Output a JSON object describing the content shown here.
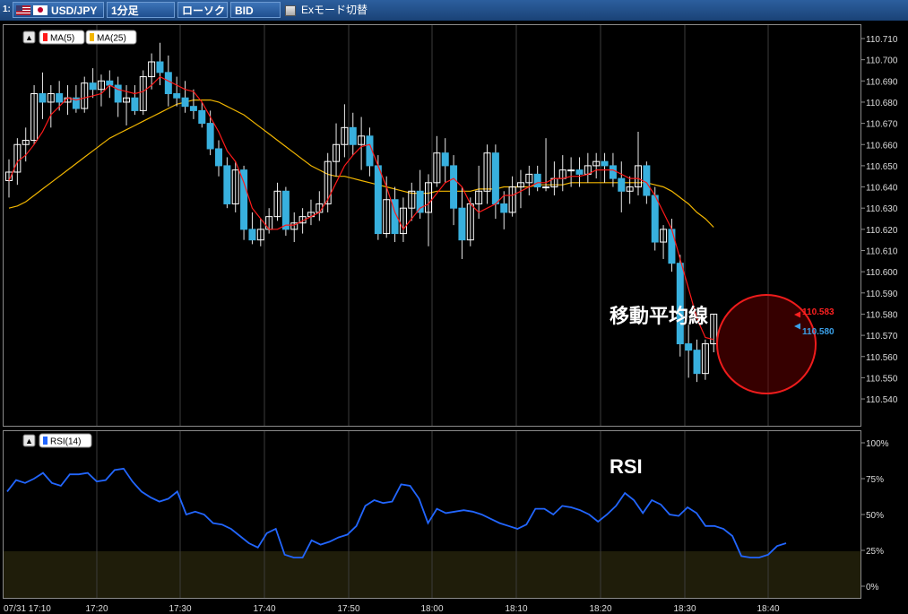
{
  "toolbar": {
    "index": "1:",
    "pair": "USD/JPY",
    "timeframe": "1分足",
    "chart_type": "ローソク",
    "price_type": "BID",
    "ex_mode": "Exモード切替"
  },
  "colors": {
    "bull": "#ffffff",
    "bear": "#38b0de",
    "wick": "#e8e8e8",
    "ma5": "#ff1a1a",
    "ma25": "#f2b600",
    "rsi": "#2266ff",
    "grid": "#3b3b3b",
    "oversold_zone": "#1f1d0a"
  },
  "chart_data": [
    {
      "type": "candlestick",
      "legend": [
        "MA(5)",
        "MA(25)"
      ],
      "annotation": "移動平均線",
      "price_labels": {
        "ma": "110.583",
        "bid": "110.580"
      },
      "ylim": [
        110.535,
        110.715
      ],
      "y_ticks": [
        "110.710",
        "110.700",
        "110.690",
        "110.680",
        "110.670",
        "110.660",
        "110.650",
        "110.640",
        "110.630",
        "110.620",
        "110.610",
        "110.600",
        "110.590",
        "110.580",
        "110.570",
        "110.560",
        "110.550",
        "110.540"
      ],
      "x_ticks": [
        "07/31 17:10",
        "17:20",
        "17:30",
        "17:40",
        "17:50",
        "18:00",
        "18:10",
        "18:20",
        "18:30",
        "18:40"
      ],
      "ohlc": [
        [
          110.643,
          110.653,
          110.635,
          110.647
        ],
        [
          110.647,
          110.663,
          110.641,
          110.66
        ],
        [
          110.66,
          110.668,
          110.652,
          110.662
        ],
        [
          110.662,
          110.688,
          110.66,
          110.684
        ],
        [
          110.684,
          110.694,
          110.672,
          110.68
        ],
        [
          110.68,
          110.688,
          110.668,
          110.684
        ],
        [
          110.684,
          110.69,
          110.676,
          110.68
        ],
        [
          110.68,
          110.688,
          110.674,
          110.682
        ],
        [
          110.682,
          110.688,
          110.675,
          110.677
        ],
        [
          110.677,
          110.692,
          110.675,
          110.689
        ],
        [
          110.689,
          110.696,
          110.682,
          110.686
        ],
        [
          110.686,
          110.693,
          110.678,
          110.69
        ],
        [
          110.69,
          110.695,
          110.682,
          110.688
        ],
        [
          110.688,
          110.692,
          110.673,
          110.68
        ],
        [
          110.68,
          110.688,
          110.669,
          110.682
        ],
        [
          110.682,
          110.688,
          110.674,
          110.676
        ],
        [
          110.676,
          110.695,
          110.674,
          110.692
        ],
        [
          110.692,
          110.703,
          110.686,
          110.699
        ],
        [
          110.699,
          110.708,
          110.688,
          110.694
        ],
        [
          110.694,
          110.702,
          110.678,
          110.684
        ],
        [
          110.684,
          110.692,
          110.678,
          110.682
        ],
        [
          110.682,
          110.69,
          110.675,
          110.678
        ],
        [
          110.678,
          110.686,
          110.672,
          110.676
        ],
        [
          110.676,
          110.68,
          110.668,
          110.67
        ],
        [
          110.67,
          110.676,
          110.655,
          110.658
        ],
        [
          110.658,
          110.662,
          110.645,
          110.65
        ],
        [
          110.65,
          110.654,
          110.63,
          110.632
        ],
        [
          110.632,
          110.652,
          110.628,
          110.648
        ],
        [
          110.648,
          110.65,
          110.615,
          110.62
        ],
        [
          110.62,
          110.628,
          110.613,
          110.615
        ],
        [
          110.615,
          110.625,
          110.612,
          110.62
        ],
        [
          110.62,
          110.63,
          110.618,
          110.626
        ],
        [
          110.626,
          110.642,
          110.624,
          110.638
        ],
        [
          110.638,
          110.64,
          110.617,
          110.62
        ],
        [
          110.62,
          110.628,
          110.614,
          110.623
        ],
        [
          110.623,
          110.63,
          110.618,
          110.626
        ],
        [
          110.626,
          110.634,
          110.622,
          110.628
        ],
        [
          110.628,
          110.638,
          110.624,
          110.632
        ],
        [
          110.632,
          110.656,
          110.628,
          110.652
        ],
        [
          110.652,
          110.67,
          110.645,
          110.66
        ],
        [
          110.66,
          110.679,
          110.654,
          110.668
        ],
        [
          110.668,
          110.675,
          110.655,
          110.66
        ],
        [
          110.66,
          110.673,
          110.648,
          110.664
        ],
        [
          110.664,
          110.668,
          110.645,
          110.65
        ],
        [
          110.65,
          110.655,
          110.615,
          110.618
        ],
        [
          110.618,
          110.645,
          110.616,
          110.634
        ],
        [
          110.634,
          110.64,
          110.614,
          110.618
        ],
        [
          110.618,
          110.635,
          110.614,
          110.63
        ],
        [
          110.63,
          110.642,
          110.624,
          110.638
        ],
        [
          110.638,
          110.648,
          110.625,
          110.628
        ],
        [
          110.628,
          110.646,
          110.612,
          110.642
        ],
        [
          110.642,
          110.664,
          110.64,
          110.656
        ],
        [
          110.656,
          110.663,
          110.642,
          110.65
        ],
        [
          110.65,
          110.655,
          110.622,
          110.63
        ],
        [
          110.63,
          110.64,
          110.606,
          110.615
        ],
        [
          110.615,
          110.635,
          110.612,
          110.632
        ],
        [
          110.632,
          110.65,
          110.625,
          110.638
        ],
        [
          110.638,
          110.66,
          110.632,
          110.656
        ],
        [
          110.656,
          110.66,
          110.625,
          110.632
        ],
        [
          110.632,
          110.638,
          110.62,
          110.628
        ],
        [
          110.628,
          110.645,
          110.626,
          110.64
        ],
        [
          110.64,
          110.648,
          110.63,
          110.642
        ],
        [
          110.642,
          110.65,
          110.636,
          110.646
        ],
        [
          110.646,
          110.65,
          110.638,
          110.64
        ],
        [
          110.64,
          110.663,
          110.638,
          110.64
        ],
        [
          110.64,
          110.652,
          110.636,
          110.644
        ],
        [
          110.644,
          110.655,
          110.638,
          110.648
        ],
        [
          110.648,
          110.654,
          110.64,
          110.648
        ],
        [
          110.648,
          110.654,
          110.64,
          110.646
        ],
        [
          110.646,
          110.656,
          110.642,
          110.65
        ],
        [
          110.65,
          110.656,
          110.644,
          110.652
        ],
        [
          110.652,
          110.656,
          110.642,
          110.65
        ],
        [
          110.65,
          110.656,
          110.64,
          110.644
        ],
        [
          110.644,
          110.652,
          110.628,
          110.638
        ],
        [
          110.638,
          110.645,
          110.632,
          110.64
        ],
        [
          110.64,
          110.666,
          110.636,
          110.65
        ],
        [
          110.65,
          110.652,
          110.632,
          110.636
        ],
        [
          110.636,
          110.64,
          110.61,
          110.614
        ],
        [
          110.614,
          110.622,
          110.606,
          110.62
        ],
        [
          110.62,
          110.625,
          110.6,
          110.604
        ],
        [
          110.604,
          110.608,
          110.56,
          110.566
        ],
        [
          110.566,
          110.575,
          110.55,
          110.563
        ],
        [
          110.563,
          110.568,
          110.548,
          110.552
        ],
        [
          110.552,
          110.568,
          110.549,
          110.566
        ],
        [
          110.566,
          110.58,
          110.562,
          110.58
        ]
      ],
      "ma5": [
        110.643,
        110.652,
        110.655,
        110.66,
        110.666,
        110.674,
        110.678,
        110.682,
        110.681,
        110.682,
        110.683,
        110.684,
        110.688,
        110.686,
        110.685,
        110.684,
        110.685,
        110.688,
        110.692,
        110.69,
        110.688,
        110.686,
        110.685,
        110.68,
        110.673,
        110.666,
        110.657,
        110.652,
        110.642,
        110.63,
        110.625,
        110.62,
        110.62,
        110.622,
        110.622,
        110.624,
        110.626,
        110.628,
        110.634,
        110.642,
        110.65,
        110.655,
        110.659,
        110.66,
        110.65,
        110.64,
        110.628,
        110.62,
        110.625,
        110.63,
        110.632,
        110.637,
        110.642,
        110.644,
        110.64,
        110.632,
        110.628,
        110.63,
        110.632,
        110.636,
        110.636,
        110.638,
        110.64,
        110.642,
        110.642,
        110.644,
        110.644,
        110.645,
        110.645,
        110.646,
        110.648,
        110.648,
        110.648,
        110.646,
        110.644,
        110.644,
        110.642,
        110.636,
        110.628,
        110.62,
        110.606,
        110.592,
        110.578,
        110.569,
        110.568
      ],
      "ma25": [
        110.63,
        110.631,
        110.633,
        110.636,
        110.639,
        110.642,
        110.645,
        110.648,
        110.651,
        110.654,
        110.657,
        110.66,
        110.663,
        110.665,
        110.667,
        110.669,
        110.671,
        110.673,
        110.675,
        110.677,
        110.679,
        110.68,
        110.681,
        110.681,
        110.681,
        110.68,
        110.678,
        110.676,
        110.674,
        110.671,
        110.668,
        110.665,
        110.662,
        110.659,
        110.656,
        110.653,
        110.65,
        110.648,
        110.646,
        110.645,
        110.645,
        110.644,
        110.643,
        110.642,
        110.641,
        110.64,
        110.639,
        110.638,
        110.637,
        110.637,
        110.637,
        110.638,
        110.638,
        110.638,
        110.638,
        110.638,
        110.639,
        110.639,
        110.639,
        110.64,
        110.64,
        110.64,
        110.64,
        110.641,
        110.641,
        110.641,
        110.641,
        110.642,
        110.642,
        110.642,
        110.642,
        110.642,
        110.642,
        110.642,
        110.642,
        110.642,
        110.642,
        110.641,
        110.64,
        110.638,
        110.635,
        110.632,
        110.628,
        110.625,
        110.621
      ]
    },
    {
      "type": "line",
      "legend": [
        "RSI(14)"
      ],
      "annotation": "RSI",
      "ylim": [
        0,
        100
      ],
      "y_ticks": [
        "100%",
        "75%",
        "50%",
        "25%",
        "0%"
      ],
      "oversold_level": 25,
      "rsi": [
        66,
        74,
        72,
        75,
        79,
        72,
        70,
        78,
        78,
        79,
        73,
        74,
        81,
        82,
        73,
        66,
        62,
        59,
        61,
        66,
        50,
        52,
        50,
        44,
        43,
        40,
        35,
        30,
        27,
        37,
        40,
        22,
        20,
        20,
        32,
        29,
        31,
        34,
        36,
        42,
        56,
        60,
        58,
        59,
        71,
        70,
        61,
        44,
        54,
        51,
        52,
        53,
        52,
        50,
        47,
        44,
        42,
        40,
        43,
        54,
        54,
        50,
        56,
        55,
        53,
        50,
        45,
        50,
        56,
        65,
        60,
        51,
        60,
        57,
        50,
        49,
        55,
        51,
        42,
        42,
        40,
        35,
        21,
        20,
        20,
        22,
        28,
        30
      ]
    }
  ]
}
